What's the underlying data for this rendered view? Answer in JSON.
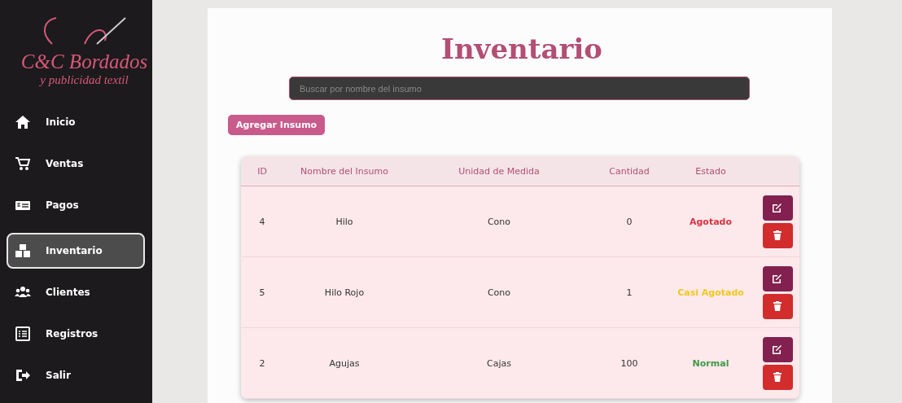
{
  "sidebar": {
    "logo": {
      "title": "C&C Bordados",
      "subtitle": "y publicidad textil"
    },
    "items": [
      {
        "label": "Inicio",
        "kind": "home",
        "selected": false
      },
      {
        "label": "Ventas",
        "kind": "cart",
        "selected": false
      },
      {
        "label": "Pagos",
        "kind": "bill",
        "selected": false
      },
      {
        "label": "Inventario",
        "kind": "boxes",
        "selected": true
      },
      {
        "label": "Clientes",
        "kind": "users",
        "selected": false
      },
      {
        "label": "Registros",
        "kind": "list",
        "selected": false
      },
      {
        "label": "Salir",
        "kind": "exit",
        "selected": false
      }
    ]
  },
  "page": {
    "title": "Inventario",
    "search": {
      "placeholder": "Buscar por nombre del insumo"
    },
    "add_button": "Agregar Insumo"
  },
  "table": {
    "columns": [
      "ID",
      "Nombre del Insumo",
      "Unidad de Medida",
      "Cantidad",
      "Estado"
    ],
    "rows": [
      {
        "id": "4",
        "name": "Hilo",
        "unit": "Cono",
        "qty": "0",
        "status": "Agotado",
        "color": "#d9303f"
      },
      {
        "id": "5",
        "name": "Hilo Rojo",
        "unit": "Cono",
        "qty": "1",
        "status": "Casi Agotado",
        "color": "#f2c81c"
      },
      {
        "id": "2",
        "name": "Agujas",
        "unit": "Cajas",
        "qty": "100",
        "status": "Normal",
        "color": "#3e9a45"
      }
    ]
  }
}
